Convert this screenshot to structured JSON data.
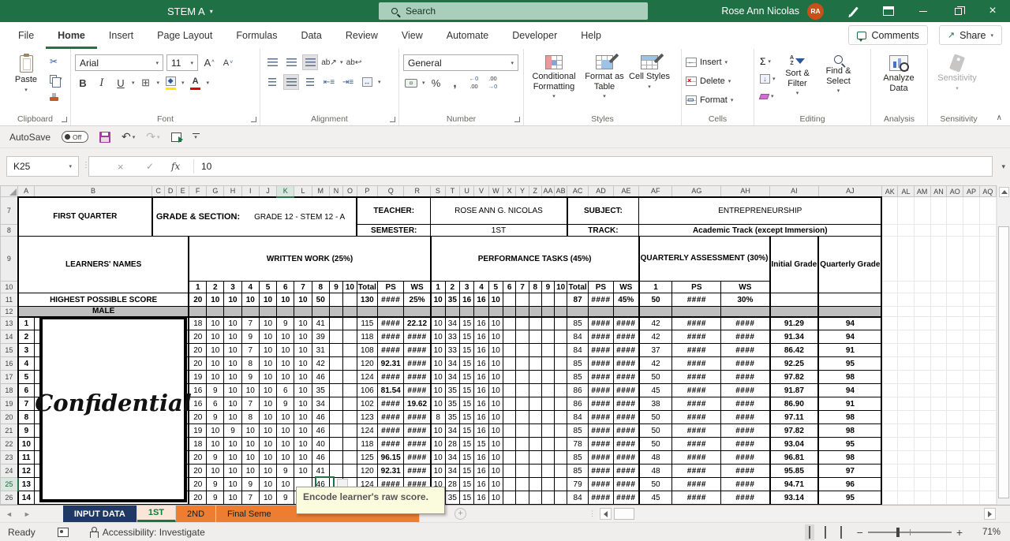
{
  "titlebar": {
    "doc_title": "STEM A",
    "search_placeholder": "Search",
    "user_name": "Rose Ann Nicolas",
    "user_initials": "RA"
  },
  "ribbon": {
    "tabs": [
      "File",
      "Home",
      "Insert",
      "Page Layout",
      "Formulas",
      "Data",
      "Review",
      "View",
      "Automate",
      "Developer",
      "Help"
    ],
    "active_tab": "Home",
    "comments_label": "Comments",
    "share_label": "Share",
    "paste_label": "Paste",
    "font_name": "Arial",
    "font_size": "11",
    "number_format": "General",
    "conditional_formatting_label": "Conditional Formatting",
    "format_as_table_label": "Format as Table",
    "cell_styles_label": "Cell Styles",
    "insert_label": "Insert",
    "delete_label": "Delete",
    "format_label": "Format",
    "sort_filter_label": "Sort & Filter",
    "find_select_label": "Find & Select",
    "analyze_data_label": "Analyze Data",
    "sensitivity_label": "Sensitivity",
    "group_labels": {
      "clipboard": "Clipboard",
      "font": "Font",
      "alignment": "Alignment",
      "number": "Number",
      "styles": "Styles",
      "cells": "Cells",
      "editing": "Editing",
      "analysis": "Analysis",
      "sensitivity": "Sensitivity"
    }
  },
  "qat": {
    "autosave_label": "AutoSave",
    "autosave_state": "Off"
  },
  "formula_bar": {
    "cell_ref": "K25",
    "value": "10"
  },
  "grid": {
    "columns": [
      "A",
      "B",
      "C",
      "D",
      "E",
      "F",
      "G",
      "H",
      "I",
      "J",
      "K",
      "L",
      "M",
      "N",
      "O",
      "P",
      "Q",
      "R",
      "S",
      "T",
      "U",
      "V",
      "W",
      "X",
      "Y",
      "Z",
      "AA",
      "AB",
      "AC",
      "AD",
      "AE",
      "AF",
      "AG",
      "AH",
      "AI",
      "AJ",
      "AK",
      "AL",
      "AM",
      "AN",
      "AO",
      "AP",
      "AQ"
    ],
    "selected_col": "K",
    "selected_row": 25,
    "row_start": 7,
    "row_end": 26,
    "header": {
      "quarter": "FIRST QUARTER",
      "gs_label": "GRADE & SECTION:",
      "gs_value": "GRADE 12 - STEM 12 - A",
      "teacher_label": "TEACHER:",
      "teacher_value": "ROSE ANN G. NICOLAS",
      "subject_label": "SUBJECT:",
      "subject_value": "ENTREPRENEURSHIP",
      "semester_label": "SEMESTER:",
      "semester_value": "1ST",
      "track_label": "TRACK:",
      "track_value": "Academic Track (except Immersion)"
    },
    "table": {
      "learners_label": "LEARNERS' NAMES",
      "ww_label": "WRITTEN WORK (25%)",
      "pt_label": "PERFORMANCE TASKS (45%)",
      "qa_label": "QUARTERLY ASSESSMENT (30%)",
      "initial_label": "Initial Grade",
      "quarterly_label": "Quarterly Grade",
      "sub_headers": [
        "1",
        "2",
        "3",
        "4",
        "5",
        "6",
        "7",
        "8",
        "9",
        "10",
        "Total",
        "PS",
        "WS"
      ],
      "qa_sub_headers": [
        "1",
        "PS",
        "WS"
      ],
      "hps_label": "HIGHEST POSSIBLE SCORE",
      "hps": {
        "ww": [
          "20",
          "10",
          "10",
          "10",
          "10",
          "10",
          "10",
          "50",
          "",
          ""
        ],
        "wt": "130",
        "wps": "####",
        "wws": "25%",
        "pt": [
          "10",
          "35",
          "16",
          "16",
          "10",
          "",
          "",
          "",
          "",
          ""
        ],
        "ptt": "87",
        "pps": "####",
        "pws": "45%",
        "qa": "50",
        "qps": "####",
        "qws": "30%"
      },
      "section_label": "MALE",
      "watermark": "Confidential",
      "students": [
        {
          "n": "1",
          "ww": [
            "18",
            "10",
            "10",
            "7",
            "10",
            "9",
            "10",
            "41",
            "",
            ""
          ],
          "wt": "115",
          "wps": "####",
          "wws": "22.12",
          "pt": [
            "10",
            "34",
            "15",
            "16",
            "10",
            "",
            "",
            "",
            "",
            ""
          ],
          "ptt": "85",
          "pps": "####",
          "pws": "####",
          "qa": "42",
          "qps": "####",
          "qws": "####",
          "ig": "91.29",
          "qg": "94"
        },
        {
          "n": "2",
          "ww": [
            "20",
            "10",
            "10",
            "9",
            "10",
            "10",
            "10",
            "39",
            "",
            ""
          ],
          "wt": "118",
          "wps": "####",
          "wws": "####",
          "pt": [
            "10",
            "33",
            "15",
            "16",
            "10",
            "",
            "",
            "",
            "",
            ""
          ],
          "ptt": "84",
          "pps": "####",
          "pws": "####",
          "qa": "42",
          "qps": "####",
          "qws": "####",
          "ig": "91.34",
          "qg": "94"
        },
        {
          "n": "3",
          "ww": [
            "20",
            "10",
            "10",
            "7",
            "10",
            "10",
            "10",
            "31",
            "",
            ""
          ],
          "wt": "108",
          "wps": "####",
          "wws": "####",
          "pt": [
            "10",
            "33",
            "15",
            "16",
            "10",
            "",
            "",
            "",
            "",
            ""
          ],
          "ptt": "84",
          "pps": "####",
          "pws": "####",
          "qa": "37",
          "qps": "####",
          "qws": "####",
          "ig": "86.42",
          "qg": "91"
        },
        {
          "n": "4",
          "ww": [
            "20",
            "10",
            "10",
            "8",
            "10",
            "10",
            "10",
            "42",
            "",
            ""
          ],
          "wt": "120",
          "wps": "92.31",
          "wws": "####",
          "pt": [
            "10",
            "34",
            "15",
            "16",
            "10",
            "",
            "",
            "",
            "",
            ""
          ],
          "ptt": "85",
          "pps": "####",
          "pws": "####",
          "qa": "42",
          "qps": "####",
          "qws": "####",
          "ig": "92.25",
          "qg": "95"
        },
        {
          "n": "5",
          "ww": [
            "19",
            "10",
            "10",
            "9",
            "10",
            "10",
            "10",
            "46",
            "",
            ""
          ],
          "wt": "124",
          "wps": "####",
          "wws": "####",
          "pt": [
            "10",
            "34",
            "15",
            "16",
            "10",
            "",
            "",
            "",
            "",
            ""
          ],
          "ptt": "85",
          "pps": "####",
          "pws": "####",
          "qa": "50",
          "qps": "####",
          "qws": "####",
          "ig": "97.82",
          "qg": "98"
        },
        {
          "n": "6",
          "ww": [
            "16",
            "9",
            "10",
            "10",
            "10",
            "6",
            "10",
            "35",
            "",
            ""
          ],
          "wt": "106",
          "wps": "81.54",
          "wws": "####",
          "pt": [
            "10",
            "35",
            "15",
            "16",
            "10",
            "",
            "",
            "",
            "",
            ""
          ],
          "ptt": "86",
          "pps": "####",
          "pws": "####",
          "qa": "45",
          "qps": "####",
          "qws": "####",
          "ig": "91.87",
          "qg": "94"
        },
        {
          "n": "7",
          "ww": [
            "16",
            "6",
            "10",
            "7",
            "10",
            "9",
            "10",
            "34",
            "",
            ""
          ],
          "wt": "102",
          "wps": "####",
          "wws": "19.62",
          "pt": [
            "10",
            "35",
            "15",
            "16",
            "10",
            "",
            "",
            "",
            "",
            ""
          ],
          "ptt": "86",
          "pps": "####",
          "pws": "####",
          "qa": "38",
          "qps": "####",
          "qws": "####",
          "ig": "86.90",
          "qg": "91"
        },
        {
          "n": "8",
          "ww": [
            "20",
            "9",
            "10",
            "8",
            "10",
            "10",
            "10",
            "46",
            "",
            ""
          ],
          "wt": "123",
          "wps": "####",
          "wws": "####",
          "pt": [
            "8",
            "35",
            "15",
            "16",
            "10",
            "",
            "",
            "",
            "",
            ""
          ],
          "ptt": "84",
          "pps": "####",
          "pws": "####",
          "qa": "50",
          "qps": "####",
          "qws": "####",
          "ig": "97.11",
          "qg": "98"
        },
        {
          "n": "9",
          "ww": [
            "19",
            "10",
            "9",
            "10",
            "10",
            "10",
            "10",
            "46",
            "",
            ""
          ],
          "wt": "124",
          "wps": "####",
          "wws": "####",
          "pt": [
            "10",
            "34",
            "15",
            "16",
            "10",
            "",
            "",
            "",
            "",
            ""
          ],
          "ptt": "85",
          "pps": "####",
          "pws": "####",
          "qa": "50",
          "qps": "####",
          "qws": "####",
          "ig": "97.82",
          "qg": "98"
        },
        {
          "n": "10",
          "ww": [
            "18",
            "10",
            "10",
            "10",
            "10",
            "10",
            "10",
            "40",
            "",
            ""
          ],
          "wt": "118",
          "wps": "####",
          "wws": "####",
          "pt": [
            "10",
            "28",
            "15",
            "15",
            "10",
            "",
            "",
            "",
            "",
            ""
          ],
          "ptt": "78",
          "pps": "####",
          "pws": "####",
          "qa": "50",
          "qps": "####",
          "qws": "####",
          "ig": "93.04",
          "qg": "95"
        },
        {
          "n": "11",
          "ww": [
            "20",
            "9",
            "10",
            "10",
            "10",
            "10",
            "10",
            "46",
            "",
            ""
          ],
          "wt": "125",
          "wps": "96.15",
          "wws": "####",
          "pt": [
            "10",
            "34",
            "15",
            "16",
            "10",
            "",
            "",
            "",
            "",
            ""
          ],
          "ptt": "85",
          "pps": "####",
          "pws": "####",
          "qa": "48",
          "qps": "####",
          "qws": "####",
          "ig": "96.81",
          "qg": "98"
        },
        {
          "n": "12",
          "ww": [
            "20",
            "10",
            "10",
            "10",
            "10",
            "9",
            "10",
            "41",
            "",
            ""
          ],
          "wt": "120",
          "wps": "92.31",
          "wws": "####",
          "pt": [
            "10",
            "34",
            "15",
            "16",
            "10",
            "",
            "",
            "",
            "",
            ""
          ],
          "ptt": "85",
          "pps": "####",
          "pws": "####",
          "qa": "48",
          "qps": "####",
          "qws": "####",
          "ig": "95.85",
          "qg": "97"
        },
        {
          "n": "13",
          "ww": [
            "20",
            "9",
            "10",
            "9",
            "10",
            "10",
            "",
            "46",
            "",
            ""
          ],
          "wt": "124",
          "wps": "####",
          "wws": "####",
          "pt": [
            "10",
            "28",
            "15",
            "16",
            "10",
            "",
            "",
            "",
            "",
            ""
          ],
          "ptt": "79",
          "pps": "####",
          "pws": "####",
          "qa": "50",
          "qps": "####",
          "qws": "####",
          "ig": "94.71",
          "qg": "96"
        },
        {
          "n": "14",
          "ww": [
            "20",
            "9",
            "10",
            "7",
            "10",
            "9",
            "",
            "",
            "",
            ""
          ],
          "wt": "",
          "wps": "",
          "wws": "",
          "pt": [
            "8",
            "35",
            "15",
            "16",
            "10",
            "",
            "",
            "",
            "",
            ""
          ],
          "ptt": "84",
          "pps": "####",
          "pws": "####",
          "qa": "45",
          "qps": "####",
          "qws": "####",
          "ig": "93.14",
          "qg": "95"
        }
      ]
    },
    "tooltip": "Encode learner's raw score."
  },
  "sheet_tabs": {
    "tabs": [
      {
        "label": "INPUT DATA",
        "type": "navy"
      },
      {
        "label": "1ST",
        "type": "active"
      },
      {
        "label": "2ND",
        "type": "orange"
      },
      {
        "label": "Final Seme",
        "type": "orange"
      }
    ],
    "active": "1ST"
  },
  "status_bar": {
    "ready": "Ready",
    "accessibility": "Accessibility: Investigate",
    "zoom": "71%"
  }
}
